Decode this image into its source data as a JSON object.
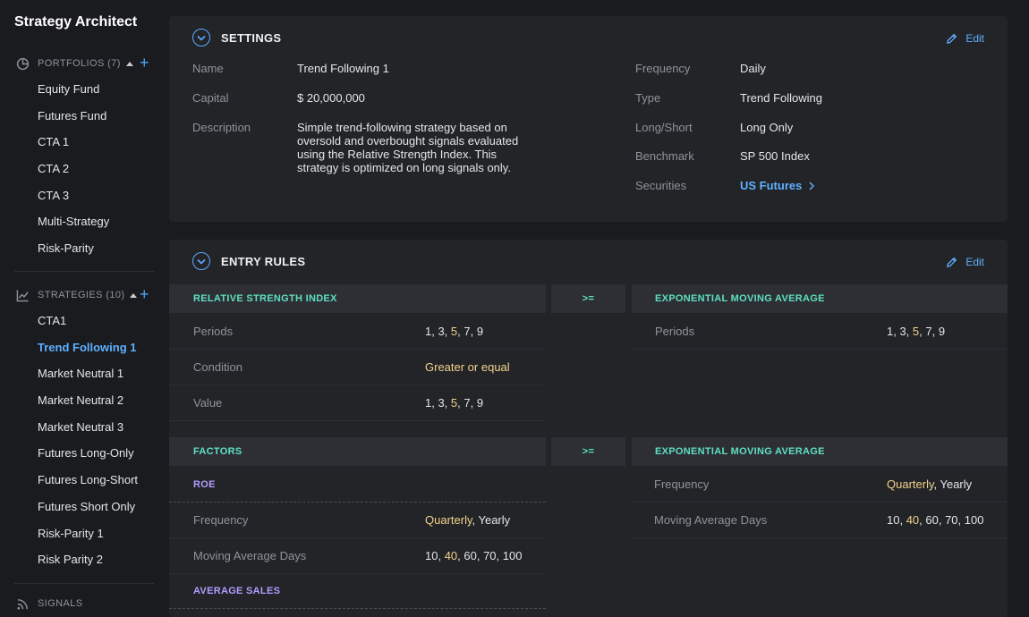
{
  "app": {
    "title": "Strategy Architect"
  },
  "sidebar": {
    "portfolios": {
      "title": "PORTFOLIOS (7)",
      "items": [
        "Equity Fund",
        "Futures Fund",
        "CTA 1",
        "CTA 2",
        "CTA 3",
        "Multi-Strategy",
        "Risk-Parity"
      ]
    },
    "strategies": {
      "title": "STRATEGIES (10)",
      "items": [
        "CTA1",
        "Trend Following 1",
        "Market Neutral 1",
        "Market Neutral 2",
        "Market Neutral 3",
        "Futures Long-Only",
        "Futures Long-Short",
        "Futures Short Only",
        "Risk-Parity 1",
        "Risk Parity 2"
      ],
      "active": "Trend Following 1"
    },
    "signals": {
      "title": "SIGNALS"
    }
  },
  "settings": {
    "title": "SETTINGS",
    "edit_label": "Edit",
    "name": {
      "label": "Name",
      "value": "Trend Following 1"
    },
    "capital": {
      "label": "Capital",
      "value": "$ 20,000,000"
    },
    "description": {
      "label": "Description",
      "value": "Simple trend-following strategy based on oversold and overbought signals evaluated using the Relative Strength Index.  This strategy is optimized on long signals only."
    },
    "frequency": {
      "label": "Frequency",
      "value": "Daily"
    },
    "type": {
      "label": "Type",
      "value": "Trend Following"
    },
    "long_short": {
      "label": "Long/Short",
      "value": "Long Only"
    },
    "benchmark": {
      "label": "Benchmark",
      "value": "SP 500 Index"
    },
    "securities": {
      "label": "Securities",
      "value": "US Futures"
    }
  },
  "entry_rules": {
    "title": "ENTRY RULES",
    "edit_label": "Edit",
    "rule1": {
      "left_header": "RELATIVE STRENGTH INDEX",
      "operator": ">=",
      "right_header": "EXPONENTIAL MOVING AVERAGE",
      "left_rows": [
        {
          "label": "Periods",
          "parts": [
            "1, 3, ",
            "5",
            ", 7, 9"
          ]
        },
        {
          "label": "Condition",
          "parts": [
            "",
            "Greater or equal",
            ""
          ]
        },
        {
          "label": "Value",
          "parts": [
            "1, 3, ",
            "5",
            ", 7, 9"
          ]
        }
      ],
      "right_rows": [
        {
          "label": "Periods",
          "parts": [
            "1, 3, ",
            "5",
            ", 7, 9"
          ]
        }
      ]
    },
    "rule2": {
      "left_header": "FACTORS",
      "operator": ">=",
      "right_header": "EXPONENTIAL MOVING AVERAGE",
      "factor1": "ROE",
      "factor2": "AVERAGE SALES",
      "left_rows": [
        {
          "label": "Frequency",
          "parts": [
            "",
            "Quarterly",
            ", Yearly"
          ]
        },
        {
          "label": "Moving Average Days",
          "parts": [
            "10, ",
            "40",
            ", 60, 70, 100"
          ]
        }
      ],
      "right_rows": [
        {
          "label": "Frequency",
          "parts": [
            "",
            "Quarterly",
            ", Yearly"
          ]
        },
        {
          "label": "Moving Average Days",
          "parts": [
            "10, ",
            "40",
            ", 60, 70, 100"
          ]
        }
      ]
    }
  },
  "colors": {
    "accent": "#5fb0ff",
    "teal": "#5ee0c0",
    "purple": "#b39cff",
    "highlight": "#f2d28c"
  },
  "icons": [
    "pie-chart-icon",
    "line-chart-icon",
    "rss-icon",
    "chevron-down-icon",
    "pencil-icon",
    "chevron-right-icon"
  ]
}
